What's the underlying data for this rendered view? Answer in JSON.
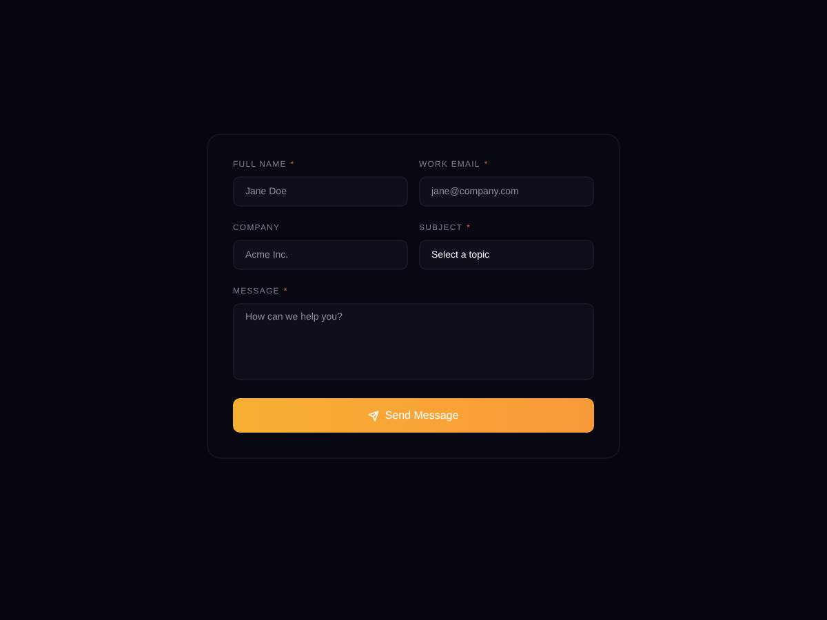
{
  "form": {
    "fields": [
      {
        "kind": "input",
        "label": "FULL NAME",
        "required_mark": "*",
        "placeholder": "Jane Doe"
      },
      {
        "kind": "input",
        "label": "WORK EMAIL",
        "required_mark": "*",
        "placeholder": "jane@company.com"
      },
      {
        "kind": "input",
        "label": "COMPANY",
        "placeholder": "Acme Inc."
      },
      {
        "kind": "select",
        "label": "SUBJECT",
        "required_mark": "*",
        "value": "Select a topic"
      },
      {
        "kind": "textarea",
        "label": "MESSAGE",
        "required_mark": "*",
        "placeholder": "How can we help you?"
      }
    ],
    "submit": {
      "label": "Send Message"
    }
  }
}
